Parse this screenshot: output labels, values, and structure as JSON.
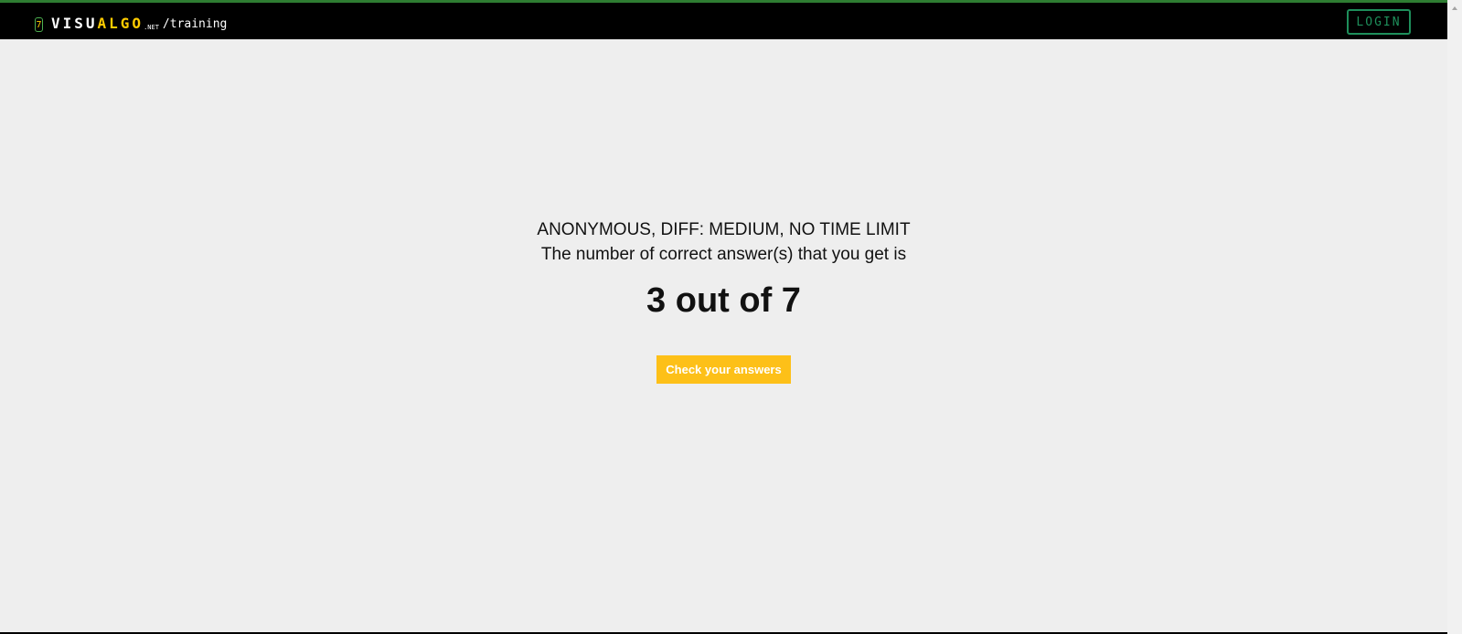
{
  "header": {
    "logo_badge": "7",
    "logo_visu": "VISU",
    "logo_algo": "ALGO",
    "logo_net": ".NET",
    "logo_path": "/training",
    "login_label": "LOGIN"
  },
  "result": {
    "status_line": "ANONYMOUS, DIFF: MEDIUM, NO TIME LIMIT",
    "message": "The number of correct answer(s) that you get is",
    "score_text": "3 out of 7",
    "correct": 3,
    "total": 7,
    "check_button_label": "Check your answers"
  },
  "colors": {
    "navbar": "#000000",
    "accent_yellow": "#fdc018",
    "login_green": "#1e8f5b",
    "background": "#eeeeee"
  }
}
